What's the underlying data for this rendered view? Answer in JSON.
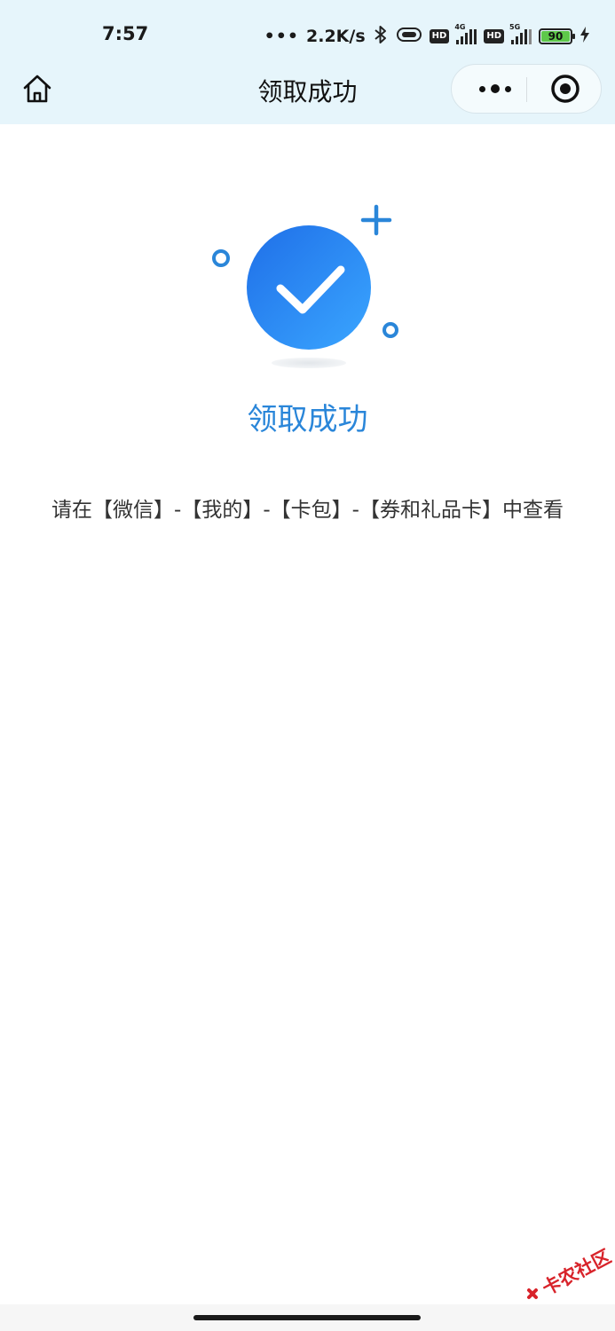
{
  "status_bar": {
    "time": "7:57",
    "dots": "•••",
    "net_speed": "2.2K/s",
    "hd_label": "HD",
    "signal1_tag": "4G",
    "signal2_tag": "5G",
    "battery_level": "90",
    "icons": [
      "bluetooth-icon",
      "vibrate-icon",
      "hd-icon",
      "signal-4g-icon",
      "signal-5g-icon",
      "battery-icon",
      "charging-icon"
    ]
  },
  "navbar": {
    "title": "领取成功",
    "home_icon": "home-icon",
    "more_icon": "more-dots-icon",
    "close_icon": "target-close-icon"
  },
  "result": {
    "title": "领取成功",
    "icon": "check-circle-icon",
    "hint": "请在【微信】-【我的】-【卡包】-【券和礼品卡】中查看"
  },
  "watermark": {
    "text": "卡农社区"
  },
  "colors": {
    "topbar_bg": "#e6f5fb",
    "accent_blue": "#2a86d9",
    "check_gradient_start": "#1f6fe8",
    "check_gradient_end": "#3aa6ff"
  }
}
